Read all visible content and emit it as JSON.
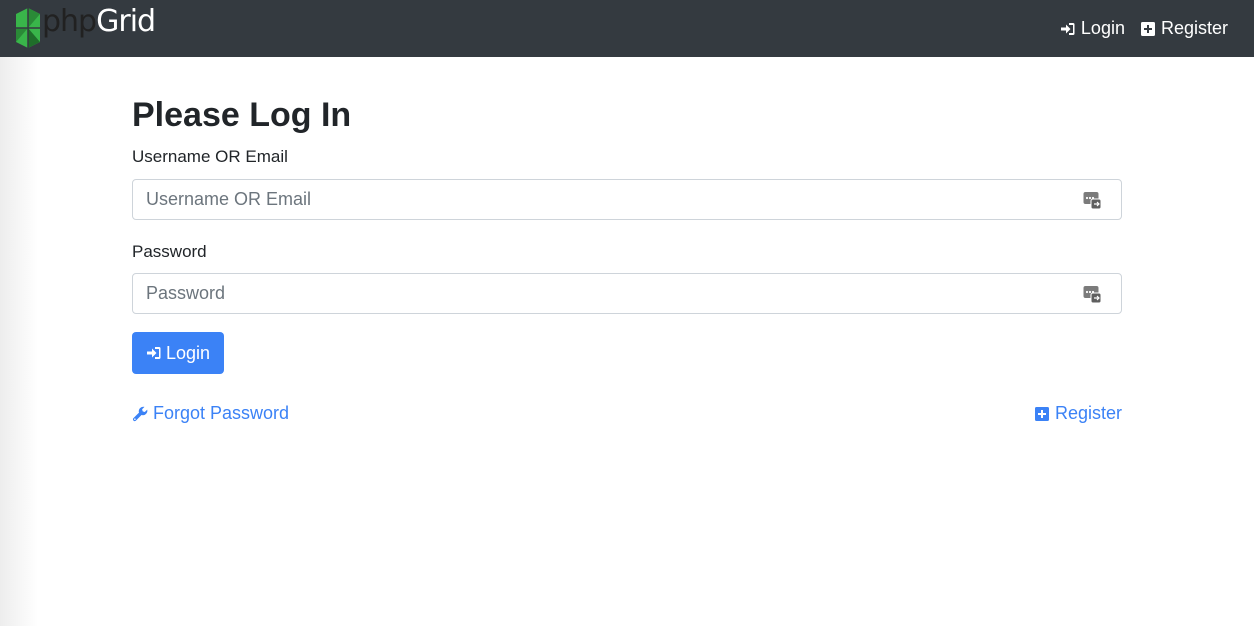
{
  "navbar": {
    "brand": {
      "prefix": "php",
      "suffix": "Grid",
      "logo_icon": "phpgrid-logo-icon"
    },
    "links": [
      {
        "label": "Login",
        "icon": "sign-in-icon"
      },
      {
        "label": "Register",
        "icon": "plus-square-icon"
      }
    ]
  },
  "form": {
    "title": "Please Log In",
    "username": {
      "label": "Username OR Email",
      "placeholder": "Username OR Email",
      "value": "",
      "icon": "password-manager-icon"
    },
    "password": {
      "label": "Password",
      "placeholder": "Password",
      "value": "",
      "icon": "password-manager-icon"
    },
    "submit": {
      "label": "Login",
      "icon": "sign-in-icon"
    },
    "forgot": {
      "label": "Forgot Password",
      "icon": "wrench-icon"
    },
    "register": {
      "label": "Register",
      "icon": "plus-square-icon"
    }
  },
  "colors": {
    "navbar_bg": "#343a40",
    "primary": "#3b82f6",
    "logo_green": "#39b54a"
  }
}
